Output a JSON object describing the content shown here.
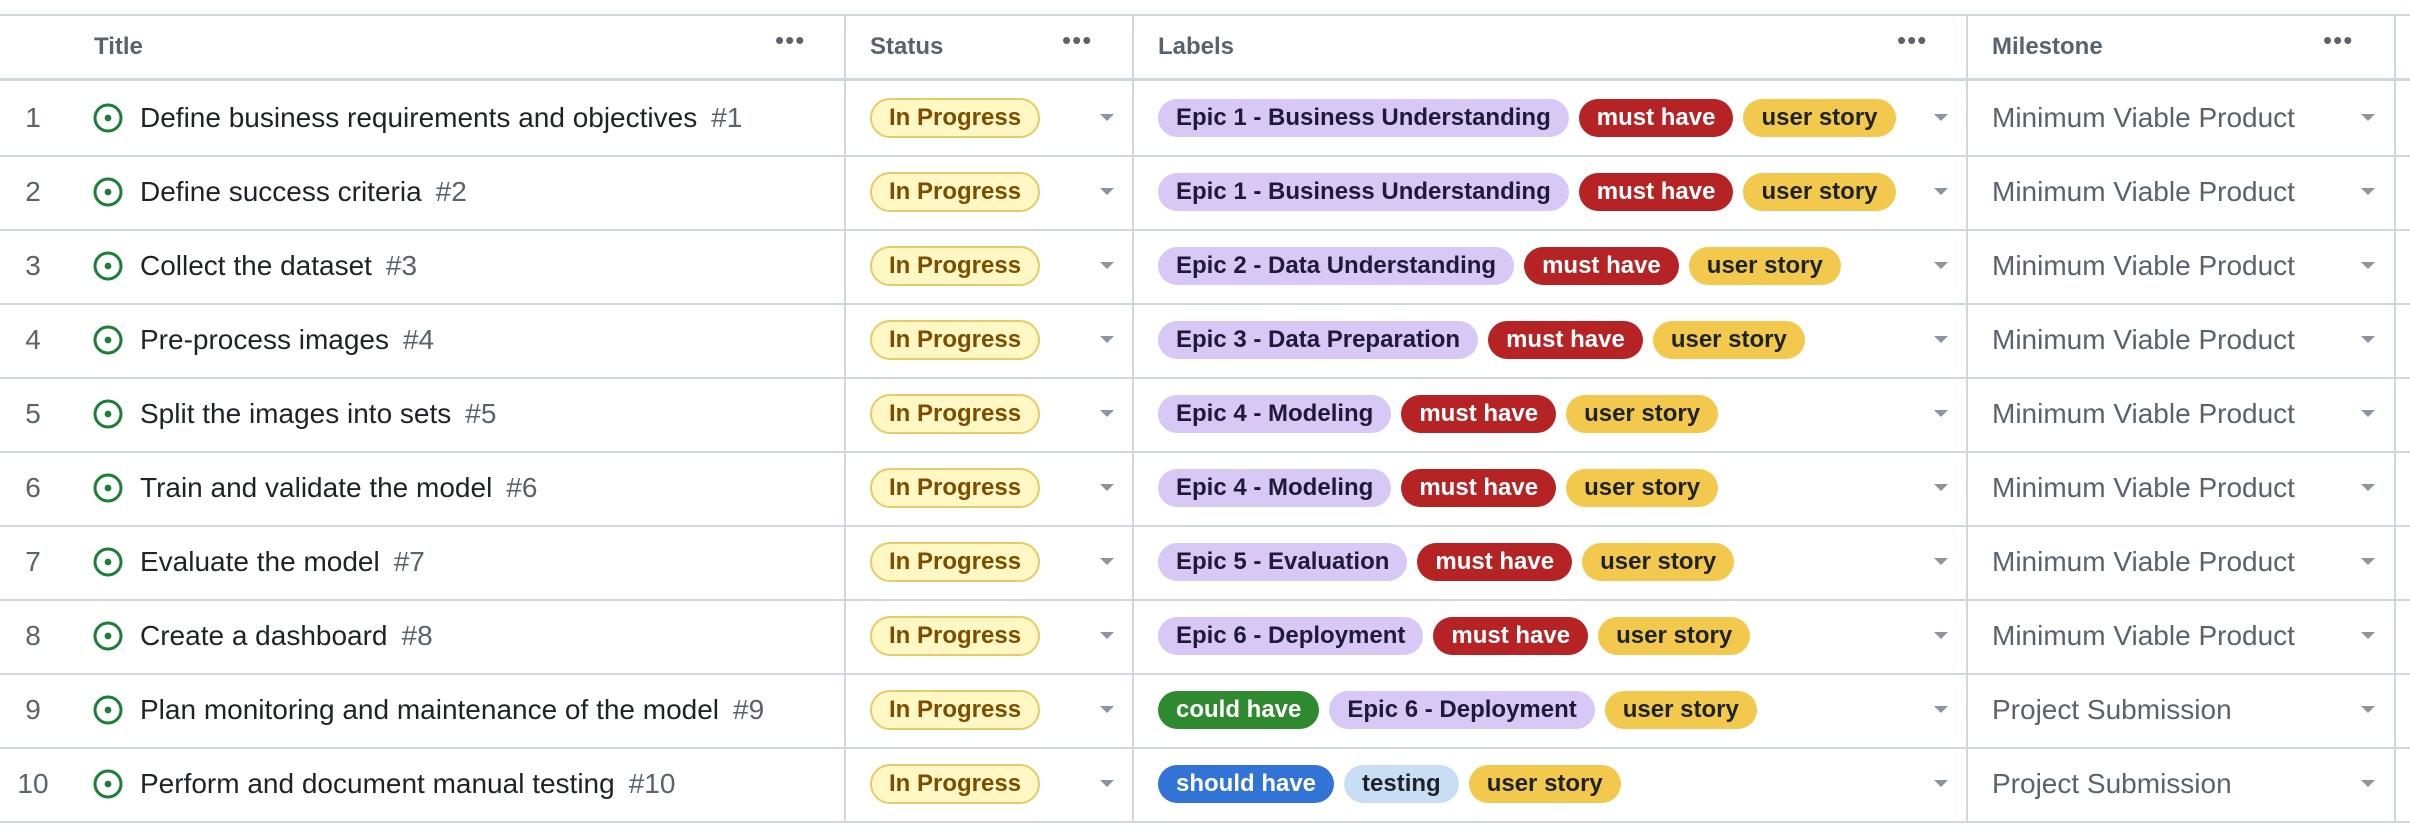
{
  "columns": {
    "title": "Title",
    "status": "Status",
    "labels": "Labels",
    "milestone": "Milestone",
    "menu_glyph": "•••"
  },
  "label_colors": {
    "Epic 1 - Business Understanding": {
      "bg": "#d8c8f5",
      "fg": "#1f1a3a"
    },
    "Epic 2 - Data Understanding": {
      "bg": "#d8c8f5",
      "fg": "#1f1a3a"
    },
    "Epic 3 - Data Preparation": {
      "bg": "#d8c8f5",
      "fg": "#1f1a3a"
    },
    "Epic 4 - Modeling": {
      "bg": "#d8c8f5",
      "fg": "#1f1a3a"
    },
    "Epic 5 - Evaluation": {
      "bg": "#d8c8f5",
      "fg": "#1f1a3a"
    },
    "Epic 6 - Deployment": {
      "bg": "#d8c8f5",
      "fg": "#1f1a3a"
    },
    "must have": {
      "bg": "#b62324",
      "fg": "#ffffff"
    },
    "user story": {
      "bg": "#f2c94c",
      "fg": "#1f2328"
    },
    "could have": {
      "bg": "#2f8a2f",
      "fg": "#ffffff"
    },
    "should have": {
      "bg": "#3174d6",
      "fg": "#ffffff"
    },
    "testing": {
      "bg": "#c9def5",
      "fg": "#1f2328"
    }
  },
  "status_icon": "issue-open-icon",
  "accent_color": "#1a7f37",
  "rows": [
    {
      "num": "1",
      "title": "Define business requirements and objectives",
      "issue": "#1",
      "status": "In Progress",
      "labels": [
        "Epic 1 - Business Understanding",
        "must have",
        "user story"
      ],
      "milestone": "Minimum Viable Product"
    },
    {
      "num": "2",
      "title": "Define success criteria",
      "issue": "#2",
      "status": "In Progress",
      "labels": [
        "Epic 1 - Business Understanding",
        "must have",
        "user story"
      ],
      "milestone": "Minimum Viable Product"
    },
    {
      "num": "3",
      "title": "Collect the dataset",
      "issue": "#3",
      "status": "In Progress",
      "labels": [
        "Epic 2 - Data Understanding",
        "must have",
        "user story"
      ],
      "milestone": "Minimum Viable Product"
    },
    {
      "num": "4",
      "title": "Pre-process images",
      "issue": "#4",
      "status": "In Progress",
      "labels": [
        "Epic 3 - Data Preparation",
        "must have",
        "user story"
      ],
      "milestone": "Minimum Viable Product"
    },
    {
      "num": "5",
      "title": "Split the images into sets",
      "issue": "#5",
      "status": "In Progress",
      "labels": [
        "Epic 4 - Modeling",
        "must have",
        "user story"
      ],
      "milestone": "Minimum Viable Product"
    },
    {
      "num": "6",
      "title": "Train and validate the model",
      "issue": "#6",
      "status": "In Progress",
      "labels": [
        "Epic 4 - Modeling",
        "must have",
        "user story"
      ],
      "milestone": "Minimum Viable Product"
    },
    {
      "num": "7",
      "title": "Evaluate the model",
      "issue": "#7",
      "status": "In Progress",
      "labels": [
        "Epic 5 - Evaluation",
        "must have",
        "user story"
      ],
      "milestone": "Minimum Viable Product"
    },
    {
      "num": "8",
      "title": "Create a dashboard",
      "issue": "#8",
      "status": "In Progress",
      "labels": [
        "Epic 6 - Deployment",
        "must have",
        "user story"
      ],
      "milestone": "Minimum Viable Product"
    },
    {
      "num": "9",
      "title": "Plan monitoring and maintenance of the model",
      "issue": "#9",
      "status": "In Progress",
      "labels": [
        "could have",
        "Epic 6 - Deployment",
        "user story"
      ],
      "milestone": "Project Submission"
    },
    {
      "num": "10",
      "title": "Perform and document manual testing",
      "issue": "#10",
      "status": "In Progress",
      "labels": [
        "should have",
        "testing",
        "user story"
      ],
      "milestone": "Project Submission"
    }
  ]
}
